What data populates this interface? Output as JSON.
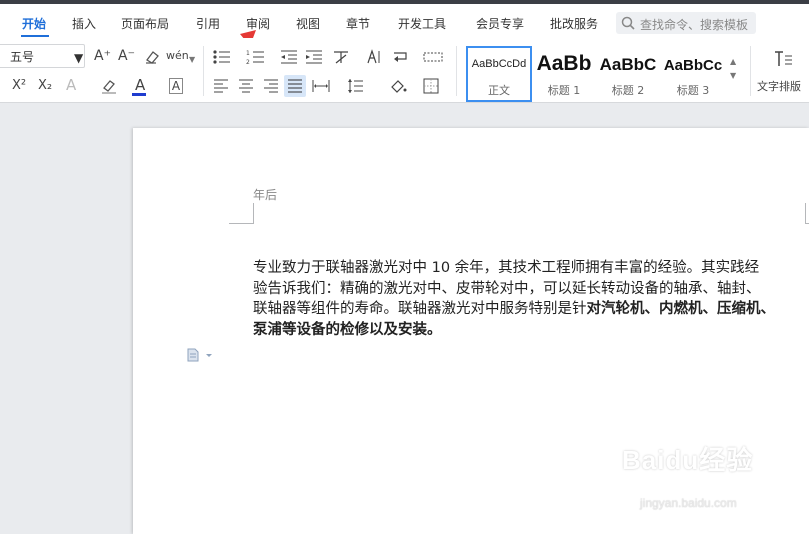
{
  "menu": {
    "tabs": [
      {
        "label": "开始",
        "active": true
      },
      {
        "label": "插入"
      },
      {
        "label": "页面布局"
      },
      {
        "label": "引用"
      },
      {
        "label": "审阅"
      },
      {
        "label": "视图"
      },
      {
        "label": "章节"
      },
      {
        "label": "开发工具"
      },
      {
        "label": "会员专享"
      },
      {
        "label": "批改服务"
      }
    ],
    "search_placeholder": "查找命令、搜索模板"
  },
  "toolbar": {
    "font_size": "五号",
    "grow_font": "A⁺",
    "shrink_font": "A⁻",
    "phonetic": "wén",
    "superscript": "X²",
    "subscript": "X₂",
    "text_effect": "A",
    "font_color": "A",
    "char_border": "A",
    "text_layout_label": "文字排版"
  },
  "styles": [
    {
      "sample": "AaBbCcDd",
      "label": "正文"
    },
    {
      "sample": "AaBb",
      "label": "标题 1"
    },
    {
      "sample": "AaBbC",
      "label": "标题 2"
    },
    {
      "sample": "AaBbCc",
      "label": "标题 3"
    }
  ],
  "document": {
    "header": "年后",
    "lines": [
      "专业致力于联轴器激光对中 10 余年，其技术工程师拥有丰富的经验。其实践经",
      "验告诉我们：精确的激光对中、皮带轮对中，可以延长转动设备的轴承、轴封、"
    ],
    "line3_normal": "联轴器等组件的寿命。联轴器激光对中服务特别是针",
    "line3_bold": "对汽轮机、内燃机、压缩机、",
    "line4_bold": "泵浦等设备的检修以及安装。"
  },
  "watermark": {
    "brand": "Baidu经验",
    "url": "jingyan.baidu.com"
  },
  "colors": {
    "accent": "#1f6fd9",
    "annotation_arrow": "#e53935"
  }
}
